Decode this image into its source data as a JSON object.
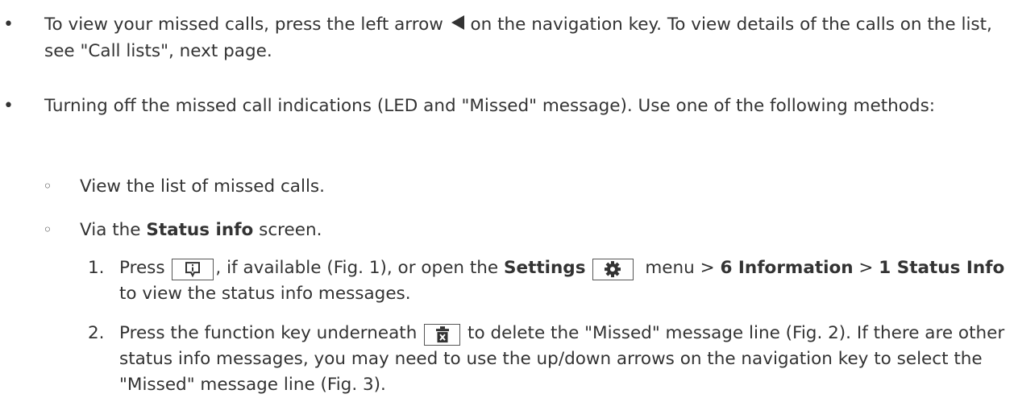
{
  "bullets": [
    {
      "marker": "•",
      "part1": "To view your missed calls, press the left arrow ",
      "part2": " on the navigation key.  To view details of the calls on the list, see \"Call lists\", next page."
    },
    {
      "marker": "•",
      "text": "Turning off the missed call indications (LED and \"Missed\" message).  Use one of the following methods:"
    }
  ],
  "sub_bullets": [
    {
      "marker": "◦",
      "text": "View the list of missed calls."
    },
    {
      "marker": "◦",
      "pre": "Via the ",
      "bold": "Status info",
      "post": " screen."
    }
  ],
  "steps": [
    {
      "number": "1.",
      "t1": "Press ",
      "t2": ", if available (Fig. 1), or open the ",
      "bold1": "Settings",
      "t3": " menu > ",
      "bold2": "6 Information",
      "t4": " > ",
      "bold3": "1 Status Info",
      "t5": " to view the status info messages."
    },
    {
      "number": "2.",
      "t1": "Press the function key underneath ",
      "t2": " to delete the \"Missed\" message line (Fig. 2).  If there are other status info messages, you may need to use the up/down arrows on the navigation key to select the \"Missed\" message line (Fig. 3)."
    }
  ],
  "icons": {
    "left_arrow": "left-triangle-arrow-icon",
    "info": "info-key-icon",
    "settings": "gear-icon",
    "delete": "trash-delete-icon"
  }
}
